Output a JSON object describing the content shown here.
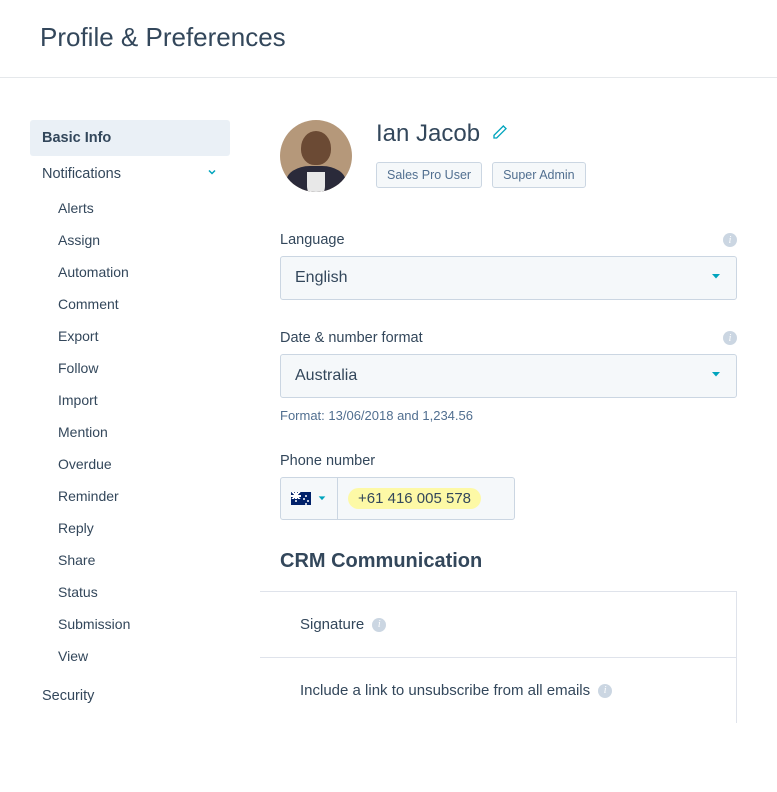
{
  "page": {
    "title": "Profile & Preferences"
  },
  "sidebar": {
    "basic_info": "Basic Info",
    "notifications": "Notifications",
    "items": [
      "Alerts",
      "Assign",
      "Automation",
      "Comment",
      "Export",
      "Follow",
      "Import",
      "Mention",
      "Overdue",
      "Reminder",
      "Reply",
      "Share",
      "Status",
      "Submission",
      "View"
    ],
    "security": "Security"
  },
  "profile": {
    "name": "Ian Jacob",
    "badges": [
      "Sales Pro User",
      "Super Admin"
    ]
  },
  "fields": {
    "language": {
      "label": "Language",
      "value": "English"
    },
    "date_format": {
      "label": "Date & number format",
      "value": "Australia",
      "help": "Format: 13/06/2018 and 1,234.56"
    },
    "phone": {
      "label": "Phone number",
      "country_flag": "au",
      "value": "+61 416 005 578"
    }
  },
  "crm": {
    "heading": "CRM Communication",
    "signature": "Signature",
    "unsubscribe": "Include a link to unsubscribe from all emails"
  }
}
